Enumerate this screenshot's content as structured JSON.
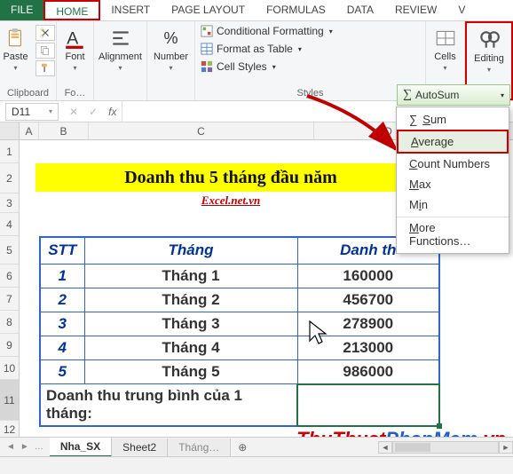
{
  "ribbon_tabs": {
    "file": "FILE",
    "home": "HOME",
    "insert": "INSERT",
    "page_layout": "PAGE LAYOUT",
    "formulas": "FORMULAS",
    "data": "DATA",
    "review": "REVIEW",
    "view_initial": "V"
  },
  "ribbon": {
    "clipboard": {
      "paste": "Paste",
      "label": "Clipboard"
    },
    "font": {
      "btn": "Font",
      "label": "Fo…"
    },
    "alignment": {
      "btn": "Alignment"
    },
    "number": {
      "btn": "Number",
      "percent": "%"
    },
    "styles": {
      "cond": "Conditional Formatting",
      "table": "Format as Table",
      "cell": "Cell Styles",
      "label": "Styles"
    },
    "cells": {
      "btn": "Cells"
    },
    "editing": {
      "btn": "Editing"
    }
  },
  "namebox": "D11",
  "columns": {
    "a": "A",
    "b": "B",
    "c": "C",
    "d": "D"
  },
  "rows": [
    "1",
    "2",
    "3",
    "4",
    "5",
    "6",
    "7",
    "8",
    "9",
    "10",
    "11",
    "12"
  ],
  "banner": "Doanh thu 5 tháng đầu năm",
  "subtitle": "Excel.net.vn",
  "table": {
    "headers": {
      "stt": "STT",
      "thang": "Tháng",
      "danhthu": "Danh th"
    },
    "rows": [
      {
        "stt": "1",
        "month": "Tháng 1",
        "value": "160000"
      },
      {
        "stt": "2",
        "month": "Tháng 2",
        "value": "456700"
      },
      {
        "stt": "3",
        "month": "Tháng 3",
        "value": "278900"
      },
      {
        "stt": "4",
        "month": "Tháng 4",
        "value": "213000"
      },
      {
        "stt": "5",
        "month": "Tháng 5",
        "value": "986000"
      }
    ],
    "footer_label": "Doanh thu trung bình của 1 tháng:"
  },
  "autosum": {
    "button": "AutoSum",
    "sigma": "∑",
    "items": {
      "sum_u": "S",
      "sum_rest": "um",
      "avg_u": "A",
      "avg_rest": "verage",
      "count_u": "C",
      "count_rest": "ount Numbers",
      "max_u": "M",
      "max_rest": "ax",
      "min": "M",
      "min_i": "i",
      "min_n": "n",
      "more_u": "M",
      "more_rest": "ore Functions…"
    }
  },
  "sheets": {
    "s1": "Nha_SX",
    "s2": "Sheet2",
    "s3": "Tháng…"
  },
  "watermark": {
    "a": "ThuThuat",
    "b": "PhanMem",
    "c": ".vn"
  }
}
